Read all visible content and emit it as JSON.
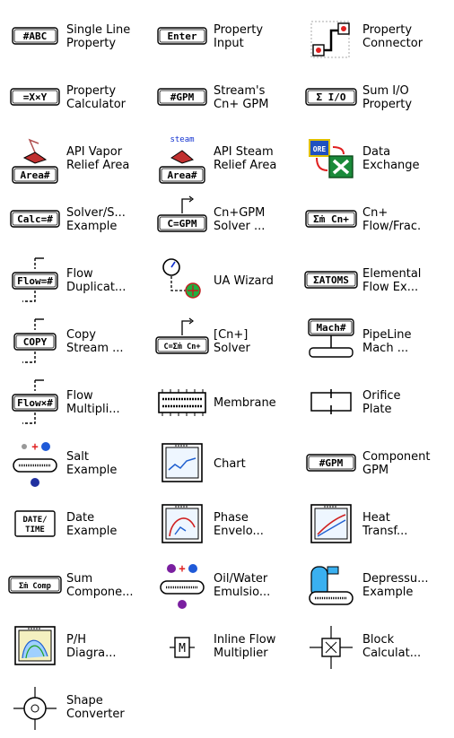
{
  "palette": {
    "items": [
      {
        "label": "Single Line\nProperty",
        "icon": "abc-property-icon",
        "icon_text": "#ABC"
      },
      {
        "label": "Property\nInput",
        "icon": "enter-input-icon",
        "icon_text": "Enter"
      },
      {
        "label": "Property\nConnector",
        "icon": "property-connector-icon",
        "icon_text": ""
      },
      {
        "label": "Property\nCalculator",
        "icon": "calculator-icon",
        "icon_text": "=X×Y"
      },
      {
        "label": "Stream's\nCn+ GPM",
        "icon": "gpm-icon",
        "icon_text": "#GPM"
      },
      {
        "label": "Sum I/O\nProperty",
        "icon": "sum-io-icon",
        "icon_text": "Σ I/O"
      },
      {
        "label": "API Vapor\nRelief Area",
        "icon": "vapor-relief-icon",
        "icon_text": "Area#"
      },
      {
        "label": "API Steam\nRelief Area",
        "icon": "steam-relief-icon",
        "icon_text": "Area#",
        "icon_top_text": "steam"
      },
      {
        "label": "Data\nExchange",
        "icon": "data-exchange-icon",
        "icon_text": ""
      },
      {
        "label": "Solver/S...\nExample",
        "icon": "calc-icon",
        "icon_text": "Calc=#"
      },
      {
        "label": "Cn+GPM\nSolver ...",
        "icon": "gpm-solver-icon",
        "icon_text": "C=GPM"
      },
      {
        "label": "Cn+\nFlow/Frac.",
        "icon": "flow-frac-icon",
        "icon_text": "Σṁ Cn+"
      },
      {
        "label": "Flow\nDuplicat...",
        "icon": "flow-duplicator-icon",
        "icon_text": "Flow=#"
      },
      {
        "label": "UA Wizard",
        "icon": "ua-wizard-icon",
        "icon_text": ""
      },
      {
        "label": "Elemental\nFlow Ex...",
        "icon": "elemental-flow-icon",
        "icon_text": "ΣATOMS"
      },
      {
        "label": "Copy\nStream ...",
        "icon": "copy-stream-icon",
        "icon_text": "COPY"
      },
      {
        "label": "[Cn+]\nSolver",
        "icon": "cn-solver-icon",
        "icon_text": "C=Σṁ Cn+"
      },
      {
        "label": "PipeLine\nMach ...",
        "icon": "pipeline-mach-icon",
        "icon_text": "Mach#"
      },
      {
        "label": "Flow\nMultipli...",
        "icon": "flow-multiplier-icon",
        "icon_text": "Flow×#"
      },
      {
        "label": "Membrane",
        "icon": "membrane-icon",
        "icon_text": ""
      },
      {
        "label": "Orifice\nPlate",
        "icon": "orifice-plate-icon",
        "icon_text": ""
      },
      {
        "label": "Salt\nExample",
        "icon": "salt-icon",
        "icon_text": ""
      },
      {
        "label": "Chart",
        "icon": "chart-icon",
        "icon_text": ""
      },
      {
        "label": "Component\nGPM",
        "icon": "component-gpm-icon",
        "icon_text": "#GPM"
      },
      {
        "label": "Date\nExample",
        "icon": "date-time-icon",
        "icon_text": "DATE/\nTIME"
      },
      {
        "label": "Phase\nEnvelo...",
        "icon": "phase-envelope-icon",
        "icon_text": ""
      },
      {
        "label": "Heat\nTransf...",
        "icon": "heat-transfer-icon",
        "icon_text": ""
      },
      {
        "label": "Sum\nCompone...",
        "icon": "sum-component-icon",
        "icon_text": "Σṁ Comp"
      },
      {
        "label": "Oil/Water\nEmulsio...",
        "icon": "oil-water-icon",
        "icon_text": ""
      },
      {
        "label": "Depressu...\nExample",
        "icon": "depressuring-icon",
        "icon_text": ""
      },
      {
        "label": "P/H\nDiagra...",
        "icon": "ph-diagram-icon",
        "icon_text": ""
      },
      {
        "label": "Inline Flow\nMultiplier",
        "icon": "inline-flow-icon",
        "icon_text": "M"
      },
      {
        "label": "Block\nCalculat...",
        "icon": "block-calculator-icon",
        "icon_text": ""
      },
      {
        "label": "Shape\nConverter",
        "icon": "shape-converter-icon",
        "icon_text": ""
      }
    ]
  }
}
